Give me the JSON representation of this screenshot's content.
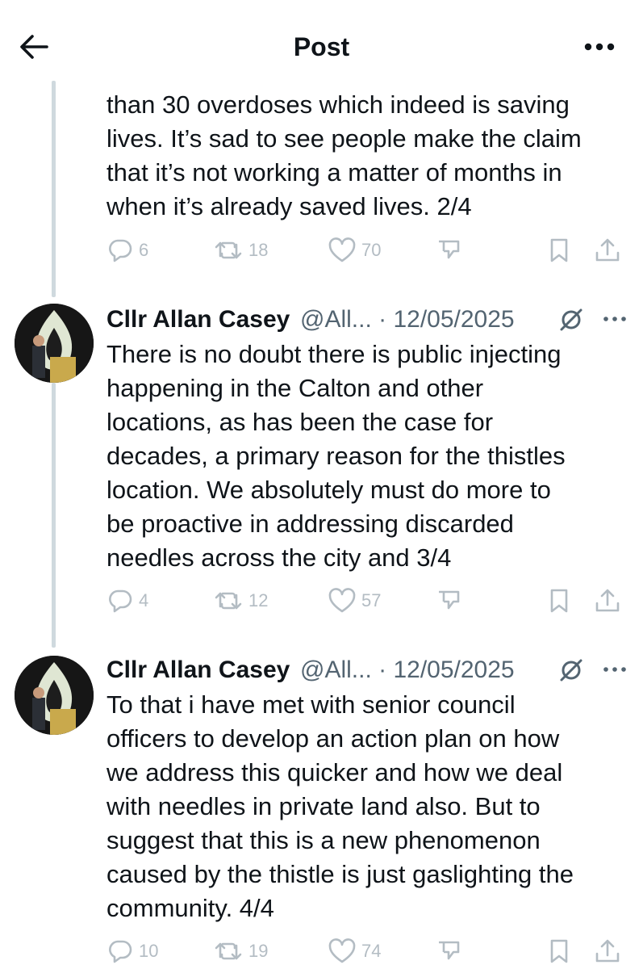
{
  "header": {
    "title": "Post",
    "back_icon": "arrow-left-icon",
    "more_icon": "more-horizontal-icon"
  },
  "tweets": [
    {
      "text_lines": [
        "than 30 overdoses which indeed is saving",
        "lives. It’s sad to see people make the claim",
        "that it’s not working a matter of months in",
        "when it’s already saved lives. 2/4"
      ],
      "replies": "6",
      "reposts": "18",
      "likes": "70"
    },
    {
      "author": "Cllr Allan Casey",
      "handle_date": "@All... · 12/05/2025",
      "text_lines": [
        "There is no doubt there is public injecting",
        "happening in the Calton and other",
        "locations, as has been the case for",
        "decades, a primary reason for the thistles",
        "location. We absolutely must do more to",
        "be proactive in addressing discarded",
        "needles across the city and  3/4"
      ],
      "replies": "4",
      "reposts": "12",
      "likes": "57"
    },
    {
      "author": "Cllr Allan Casey",
      "handle_date": "@All... · 12/05/2025",
      "text_lines": [
        "To that i have met with senior council",
        "officers to develop an action plan on how",
        "we address this quicker and how we deal",
        "with needles in private land also. But to",
        "suggest that this is a new phenomenon",
        "caused by the thistle is just gaslighting the",
        "community. 4/4"
      ],
      "replies": "10",
      "reposts": "19",
      "likes": "74"
    }
  ],
  "colors": {
    "text": "#0f1419",
    "secondary": "#536471",
    "action_faded": "#b3bcc3",
    "thread_line": "#cfd9de"
  }
}
